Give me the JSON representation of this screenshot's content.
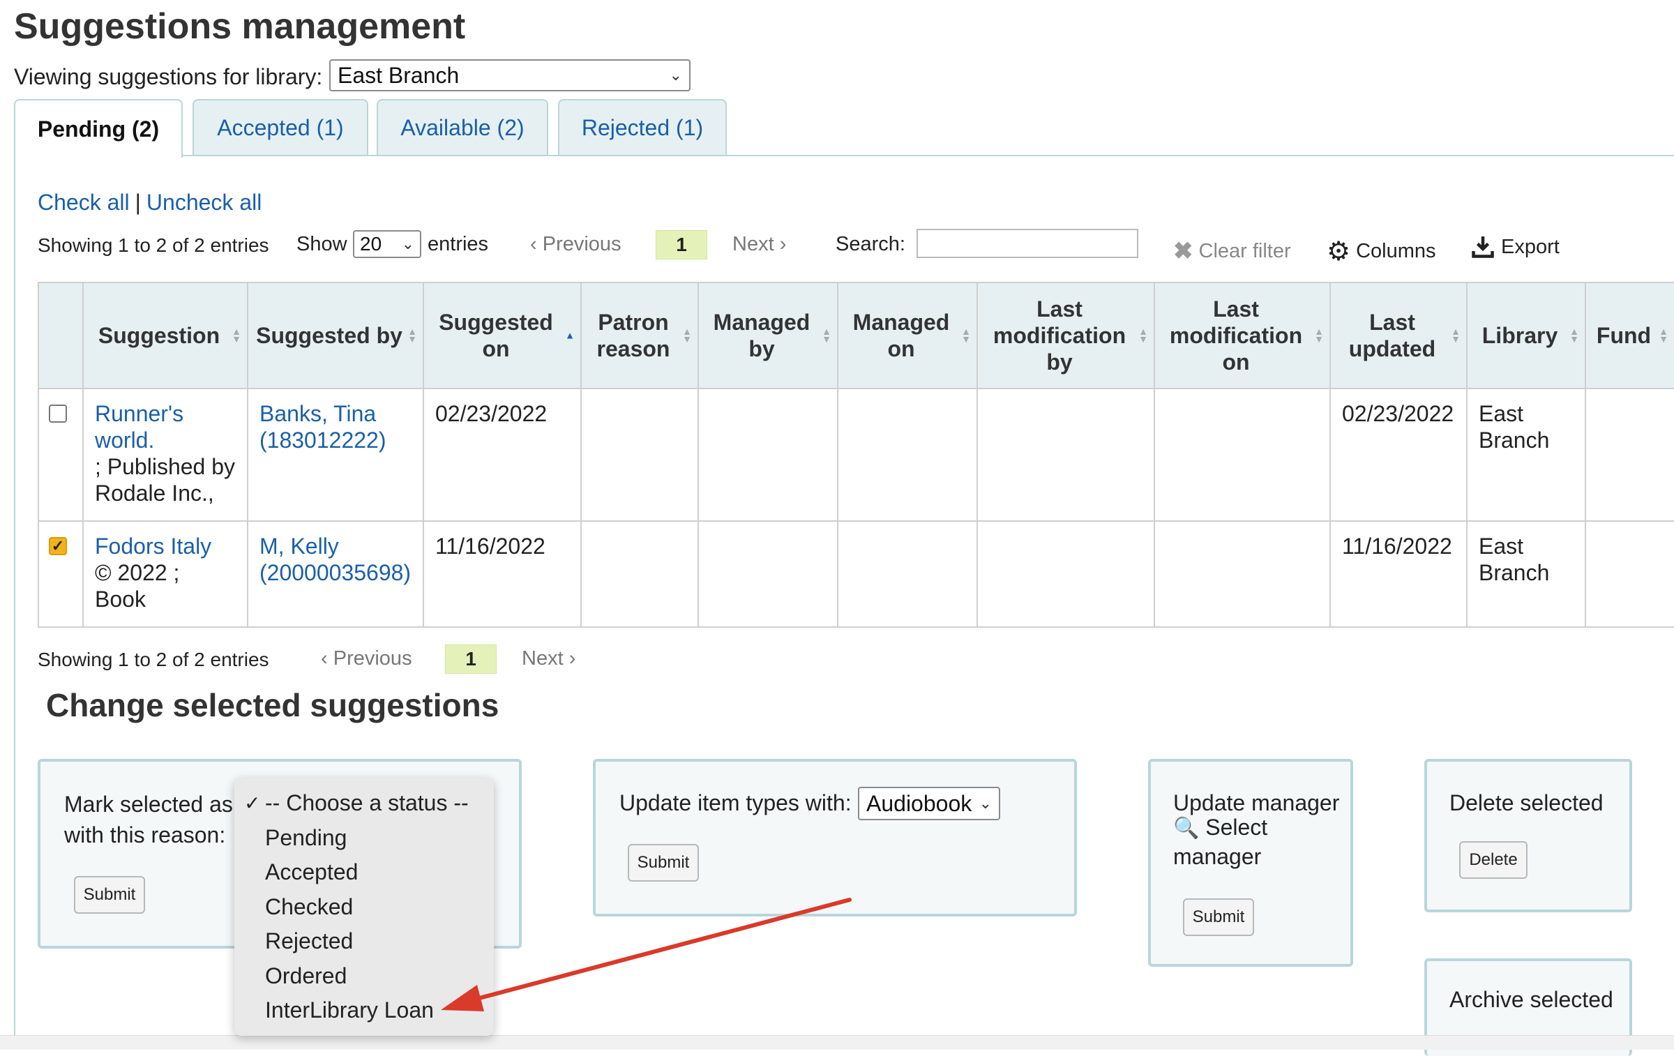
{
  "page": {
    "title": "Suggestions management",
    "library_label": "Viewing suggestions for library:",
    "library_selected": "East Branch"
  },
  "tabs": [
    {
      "label": "Pending (2)"
    },
    {
      "label": "Accepted (1)"
    },
    {
      "label": "Available (2)"
    },
    {
      "label": "Rejected (1)"
    }
  ],
  "controls": {
    "check_all": "Check all",
    "separator": "|",
    "uncheck_all": "Uncheck all",
    "showing": "Showing 1 to 2 of 2 entries",
    "show_label": "Show",
    "page_length": "20",
    "entries_label": "entries",
    "previous": "Previous",
    "current_page": "1",
    "next": "Next",
    "search_label": "Search:",
    "clear_filter": "Clear filter",
    "columns": "Columns",
    "export": "Export"
  },
  "table": {
    "headers": [
      "Suggestion",
      "Suggested by",
      "Suggested on",
      "Patron reason",
      "Managed by",
      "Managed on",
      "Last modification by",
      "Last modification on",
      "Last updated",
      "Library",
      "Fund"
    ],
    "rows": [
      {
        "checked": false,
        "title": "Runner's world.",
        "details": "; Published by Rodale Inc.,",
        "suggested_by": "Banks, Tina (183012222)",
        "suggested_on": "02/23/2022",
        "last_updated": "02/23/2022",
        "library": "East Branch"
      },
      {
        "checked": true,
        "title": "Fodors Italy",
        "details": "© 2022 ; Book",
        "suggested_by": "M, Kelly (20000035698)",
        "suggested_on": "11/16/2022",
        "last_updated": "11/16/2022",
        "library": "East Branch"
      }
    ]
  },
  "change": {
    "title": "Change selected suggestions",
    "mark_label": "Mark selected as",
    "reason_label": "with this reason:",
    "submit": "Submit",
    "update_types_label": "Update item types with:",
    "item_type_selected": "Audiobook",
    "update_manager_label": "Update manager",
    "select_manager": "Select manager",
    "delete_label": "Delete selected",
    "delete_button": "Delete",
    "archive_label": "Archive selected"
  },
  "status_options": [
    "-- Choose a status --",
    "Pending",
    "Accepted",
    "Checked",
    "Rejected",
    "Ordered",
    "InterLibrary Loan"
  ],
  "colors": {
    "link": "#1a5fa8",
    "tab_bg": "#e6f0f2",
    "page_active": "#e4f2b9",
    "checkbox_on": "#f2b41c",
    "arrow": "#d93a2a"
  }
}
